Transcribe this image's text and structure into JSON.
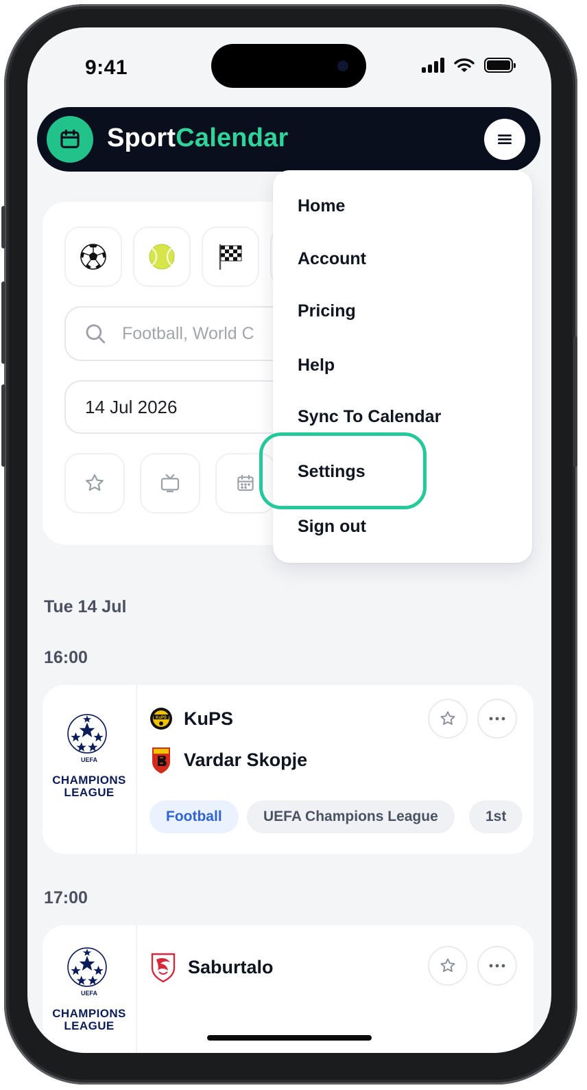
{
  "status_bar": {
    "time": "9:41"
  },
  "header": {
    "brand_part1": "Sport",
    "brand_part2": "Calendar"
  },
  "filters": {
    "sports": [
      {
        "icon": "soccer-ball-icon",
        "glyph": "⚽"
      },
      {
        "icon": "tennis-ball-icon",
        "glyph": "🎾"
      },
      {
        "icon": "checkered-flag-icon",
        "glyph": "🏁"
      }
    ],
    "search_placeholder": "Football, World C",
    "date_value": "14 Jul 2026"
  },
  "menu": {
    "items": [
      "Home",
      "Account",
      "Pricing",
      "Help",
      "Sync To Calendar",
      "Settings",
      "Sign out"
    ],
    "highlighted": "Settings",
    "highlight_color": "#22c99a"
  },
  "schedule": {
    "day_label": "Tue 14 Jul",
    "slots": [
      {
        "time": "16:00",
        "league_text": [
          "UEFA",
          "CHAMPIONS",
          "LEAGUE"
        ],
        "teams": [
          "KuPS",
          "Vardar Skopje"
        ],
        "tags": [
          "Football",
          "UEFA Champions League",
          "1st"
        ]
      },
      {
        "time": "17:00",
        "league_text": [
          "UEFA",
          "CHAMPIONS",
          "LEAGUE"
        ],
        "teams": [
          "Saburtalo"
        ]
      }
    ]
  },
  "colors": {
    "brand_green": "#2fd49a",
    "header_bg": "#0a0f1d",
    "tag_blue": "#2f63d6"
  }
}
